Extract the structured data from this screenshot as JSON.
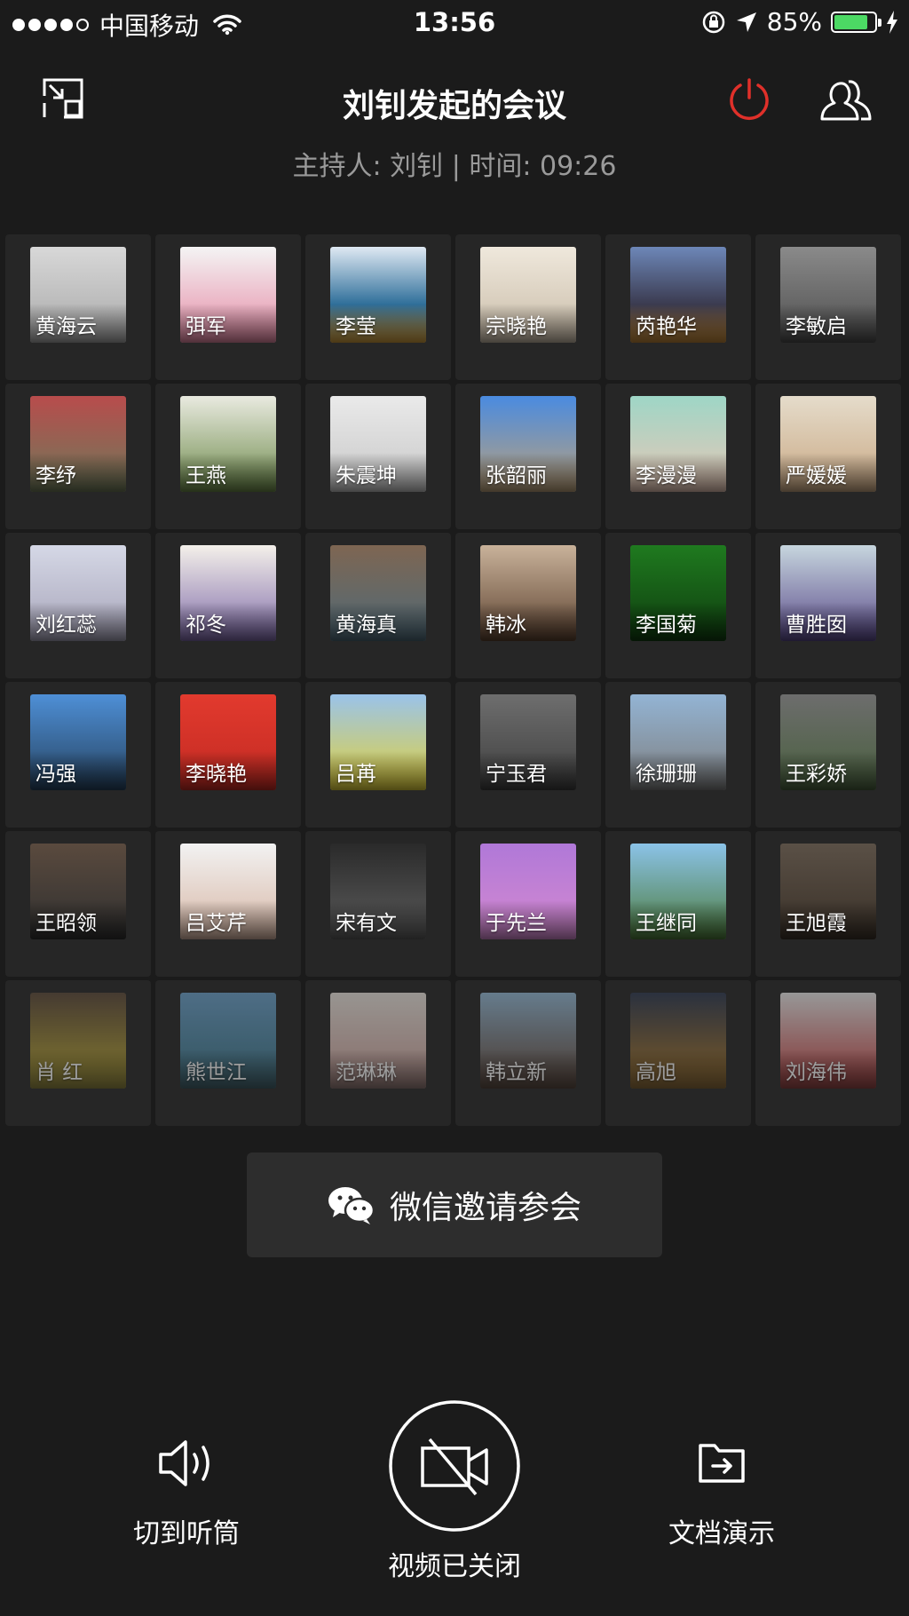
{
  "status_bar": {
    "carrier": "中国移动",
    "time": "13:56",
    "battery_percent": "85%",
    "battery_level": 0.85,
    "battery_color": "#4cd964"
  },
  "header": {
    "title": "刘钊发起的会议",
    "subtitle": "主持人: 刘钊 | 时间: 09:26",
    "power_color": "#e0302a"
  },
  "participants": [
    {
      "name": "黄海云",
      "bg": "linear-gradient(#d8d8d8,#a8a8a8)"
    },
    {
      "name": "弭军",
      "bg": "linear-gradient(#f4f4f4,#e58aa5)"
    },
    {
      "name": "李莹",
      "bg": "linear-gradient(#dfe9f3,#2f6f9a 60%,#d9a23e)"
    },
    {
      "name": "宗晓艳",
      "bg": "linear-gradient(#efe8dc,#c9bca8)"
    },
    {
      "name": "芮艳华",
      "bg": "linear-gradient(#6d87b8,#3b3b50 60%,#c48a3a)"
    },
    {
      "name": "李敏启",
      "bg": "linear-gradient(#8a8a8a,#4e4e4e)"
    },
    {
      "name": "李纾",
      "bg": "linear-gradient(#b84c4c,#6e7a5a)"
    },
    {
      "name": "王燕",
      "bg": "linear-gradient(#e9eae0,#6d8a4a)"
    },
    {
      "name": "朱震坤",
      "bg": "linear-gradient(#eaeaea,#c7c7c7)"
    },
    {
      "name": "张韶丽",
      "bg": "linear-gradient(#4a8be0,#bda27a)"
    },
    {
      "name": "李漫漫",
      "bg": "linear-gradient(#9ed6c6,#e8c7b6)"
    },
    {
      "name": "严媛媛",
      "bg": "linear-gradient(#e5dccb,#c9a883)"
    },
    {
      "name": "刘红蕊",
      "bg": "linear-gradient(#d5d8e6,#a7a4b9)"
    },
    {
      "name": "祁冬",
      "bg": "linear-gradient(#f4f0ea,#7e6aa8)"
    },
    {
      "name": "黄海真",
      "bg": "linear-gradient(#7e6652,#4f6a78)"
    },
    {
      "name": "韩冰",
      "bg": "linear-gradient(#c9b29a,#5c4230)"
    },
    {
      "name": "李国菊",
      "bg": "linear-gradient(#1f7a1f,#0f3d0f)"
    },
    {
      "name": "曹胜囡",
      "bg": "linear-gradient(#c7d6de,#5a4a8a)"
    },
    {
      "name": "冯强",
      "bg": "linear-gradient(#4e8fd6,#26425e)"
    },
    {
      "name": "李晓艳",
      "bg": "linear-gradient(#e23a2e,#c22a22)"
    },
    {
      "name": "吕苒",
      "bg": "linear-gradient(#9ac3ea,#e3d23a)"
    },
    {
      "name": "宁玉君",
      "bg": "linear-gradient(#6e6e6e,#3e3e3e)"
    },
    {
      "name": "徐珊珊",
      "bg": "linear-gradient(#93b4d4,#7e7e7e)"
    },
    {
      "name": "王彩娇",
      "bg": "linear-gradient(#6d6d6d,#49603e)"
    },
    {
      "name": "王昭领",
      "bg": "linear-gradient(#5a4a3e,#303030)"
    },
    {
      "name": "吕艾芹",
      "bg": "linear-gradient(#f2f2f2,#d7b6a4)"
    },
    {
      "name": "宋有文",
      "bg": "linear-gradient(#2a2a2a,#5e5e5e)"
    },
    {
      "name": "于先兰",
      "bg": "linear-gradient(#b078d8,#d58ad0)"
    },
    {
      "name": "王继同",
      "bg": "linear-gradient(#8bc3e8,#4c7a3a)"
    },
    {
      "name": "王旭霞",
      "bg": "linear-gradient(#5a5046,#3a3128)"
    },
    {
      "name": "肖 红",
      "bg": "linear-gradient(#5f4b3a,#d8c438)"
    },
    {
      "name": "熊世江",
      "bg": "linear-gradient(#6fa8d4,#3c7a8c)"
    },
    {
      "name": "范琳琳",
      "bg": "linear-gradient(#f5efe8,#d8a7a0)"
    },
    {
      "name": "韩立新",
      "bg": "linear-gradient(#9ac2e0,#6a4a38)"
    },
    {
      "name": "高旭",
      "bg": "linear-gradient(#2e3a52,#c78a2a)"
    },
    {
      "name": "刘海伟",
      "bg": "linear-gradient(#f4f4f4,#d23b3b)"
    }
  ],
  "invite": {
    "label": "微信邀请参会"
  },
  "controls": {
    "speaker_label": "切到听筒",
    "video_label": "视频已关闭",
    "doc_label": "文档演示"
  }
}
